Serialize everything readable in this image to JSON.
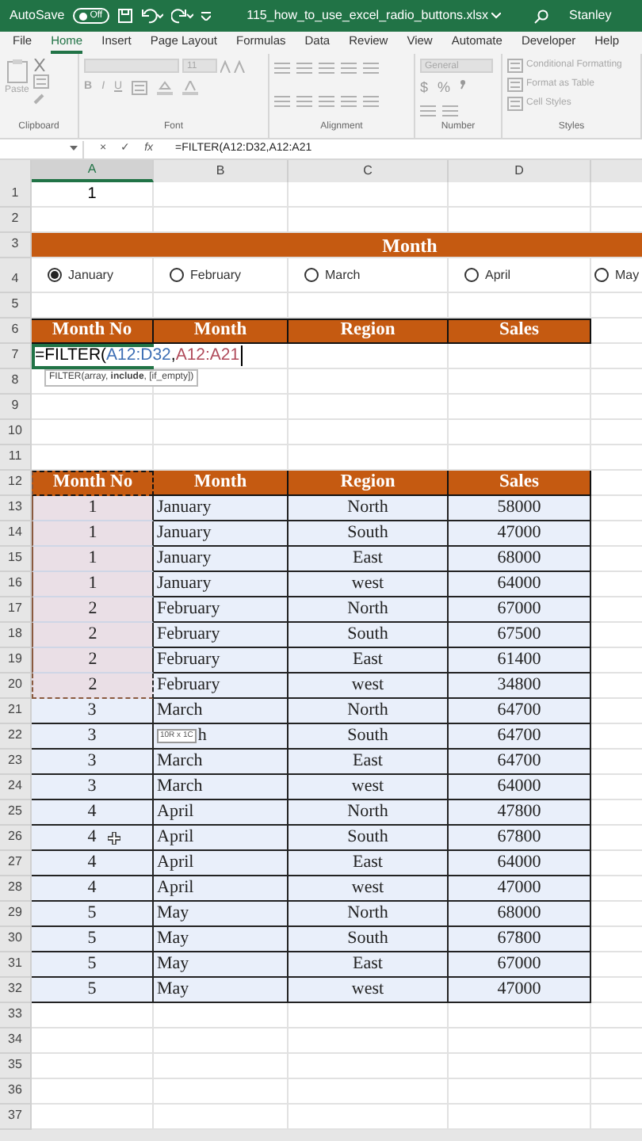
{
  "title_bar": {
    "autosave_label": "AutoSave",
    "autosave_toggle": {
      "label": "Off",
      "on": false
    },
    "filename": "115_how_to_use_excel_radio_buttons.xlsx",
    "user": "Stanley"
  },
  "ribbon_tabs": [
    {
      "label": "File",
      "selected": false
    },
    {
      "label": "Home",
      "selected": true
    },
    {
      "label": "Insert",
      "selected": false
    },
    {
      "label": "Page Layout",
      "selected": false
    },
    {
      "label": "Formulas",
      "selected": false
    },
    {
      "label": "Data",
      "selected": false
    },
    {
      "label": "Review",
      "selected": false
    },
    {
      "label": "View",
      "selected": false
    },
    {
      "label": "Automate",
      "selected": false
    },
    {
      "label": "Developer",
      "selected": false
    },
    {
      "label": "Help",
      "selected": false
    }
  ],
  "ribbon_groups": [
    {
      "kind": "clipboard",
      "label": "Clipboard",
      "paste": "Paste"
    },
    {
      "kind": "font",
      "label": "Font",
      "size": "11",
      "styles": [
        "B",
        "I",
        "U"
      ]
    },
    {
      "kind": "alignment",
      "label": "Alignment"
    },
    {
      "kind": "number",
      "label": "Number",
      "format": "General",
      "symbols": [
        "$",
        "%"
      ]
    },
    {
      "kind": "styles",
      "label": "Styles",
      "items": [
        "Conditional Formatting",
        "Format as Table",
        "Cell Styles"
      ]
    }
  ],
  "formula_bar": {
    "buttons": [
      "×",
      "✓",
      "fx"
    ],
    "formula": "=FILTER(A12:D32,A12:A21"
  },
  "columns": [
    {
      "label": "A",
      "selected": true
    },
    {
      "label": "B",
      "selected": false
    },
    {
      "label": "C",
      "selected": false
    },
    {
      "label": "D",
      "selected": false
    }
  ],
  "rows": [
    {
      "number": "1",
      "kind": "value",
      "cells": [
        "1"
      ]
    },
    {
      "number": "2",
      "kind": "empty"
    },
    {
      "number": "3",
      "kind": "banner",
      "text": "Month"
    },
    {
      "number": "4",
      "kind": "radios",
      "options": [
        {
          "label": "January",
          "selected": true
        },
        {
          "label": "February",
          "selected": false
        },
        {
          "label": "March",
          "selected": false
        },
        {
          "label": "April",
          "selected": false
        },
        {
          "label": "May",
          "selected": false
        }
      ]
    },
    {
      "number": "5",
      "kind": "empty"
    },
    {
      "number": "6",
      "kind": "header",
      "cells": [
        "Month No",
        "Month",
        "Region",
        "Sales"
      ]
    },
    {
      "number": "7",
      "kind": "formula",
      "parts": [
        {
          "text": "=FILTER("
        },
        {
          "text": "A12:D32",
          "color": "#3c6eb4"
        },
        {
          "text": ","
        },
        {
          "text": "A12:A21",
          "color": "#b04a5a"
        }
      ],
      "hint": "FILTER(array, **include**, [if_empty])"
    },
    {
      "number": "8",
      "kind": "empty"
    },
    {
      "number": "9",
      "kind": "empty"
    },
    {
      "number": "10",
      "kind": "empty"
    },
    {
      "number": "11",
      "kind": "empty"
    },
    {
      "number": "12",
      "kind": "table_header",
      "cells": [
        "Month No",
        "Month",
        "Region",
        "Sales"
      ],
      "marked": true
    },
    {
      "number": "13",
      "kind": "data",
      "cells": [
        "1",
        "January",
        "North",
        "58000"
      ],
      "marked": true
    },
    {
      "number": "14",
      "kind": "data",
      "cells": [
        "1",
        "January",
        "South",
        "47000"
      ],
      "marked": true
    },
    {
      "number": "15",
      "kind": "data",
      "cells": [
        "1",
        "January",
        "East",
        "68000"
      ],
      "marked": true
    },
    {
      "number": "16",
      "kind": "data",
      "cells": [
        "1",
        "January",
        "west",
        "64000"
      ],
      "marked": true
    },
    {
      "number": "17",
      "kind": "data",
      "cells": [
        "2",
        "February",
        "North",
        "67000"
      ],
      "marked": true
    },
    {
      "number": "18",
      "kind": "data",
      "cells": [
        "2",
        "February",
        "South",
        "67500"
      ],
      "marked": true
    },
    {
      "number": "19",
      "kind": "data",
      "cells": [
        "2",
        "February",
        "East",
        "61400"
      ],
      "marked": true
    },
    {
      "number": "20",
      "kind": "data",
      "cells": [
        "2",
        "February",
        "west",
        "34800"
      ],
      "marked": true
    },
    {
      "number": "21",
      "kind": "data",
      "cells": [
        "3",
        "March",
        "North",
        "64700"
      ],
      "marked": false
    },
    {
      "number": "22",
      "kind": "data",
      "cells": [
        "3",
        "h",
        "South",
        "64700"
      ],
      "marked": false,
      "size_tip": "10R x 1C"
    },
    {
      "number": "23",
      "kind": "data",
      "cells": [
        "3",
        "March",
        "East",
        "64700"
      ],
      "marked": false
    },
    {
      "number": "24",
      "kind": "data",
      "cells": [
        "3",
        "March",
        "west",
        "64000"
      ],
      "marked": false
    },
    {
      "number": "25",
      "kind": "data",
      "cells": [
        "4",
        "April",
        "North",
        "47800"
      ],
      "marked": false
    },
    {
      "number": "26",
      "kind": "data",
      "cells": [
        "4",
        "April",
        "South",
        "67800"
      ],
      "marked": false,
      "pointer": true
    },
    {
      "number": "27",
      "kind": "data",
      "cells": [
        "4",
        "April",
        "East",
        "64000"
      ],
      "marked": false
    },
    {
      "number": "28",
      "kind": "data",
      "cells": [
        "4",
        "April",
        "west",
        "47000"
      ],
      "marked": false
    },
    {
      "number": "29",
      "kind": "data",
      "cells": [
        "5",
        "May",
        "North",
        "68000"
      ],
      "marked": false
    },
    {
      "number": "30",
      "kind": "data",
      "cells": [
        "5",
        "May",
        "South",
        "67800"
      ],
      "marked": false
    },
    {
      "number": "31",
      "kind": "data",
      "cells": [
        "5",
        "May",
        "East",
        "67000"
      ],
      "marked": false
    },
    {
      "number": "32",
      "kind": "data",
      "cells": [
        "5",
        "May",
        "west",
        "47000"
      ],
      "marked": false
    },
    {
      "number": "33",
      "kind": "empty"
    },
    {
      "number": "34",
      "kind": "empty"
    },
    {
      "number": "35",
      "kind": "empty"
    },
    {
      "number": "36",
      "kind": "empty"
    },
    {
      "number": "37",
      "kind": "empty"
    }
  ]
}
